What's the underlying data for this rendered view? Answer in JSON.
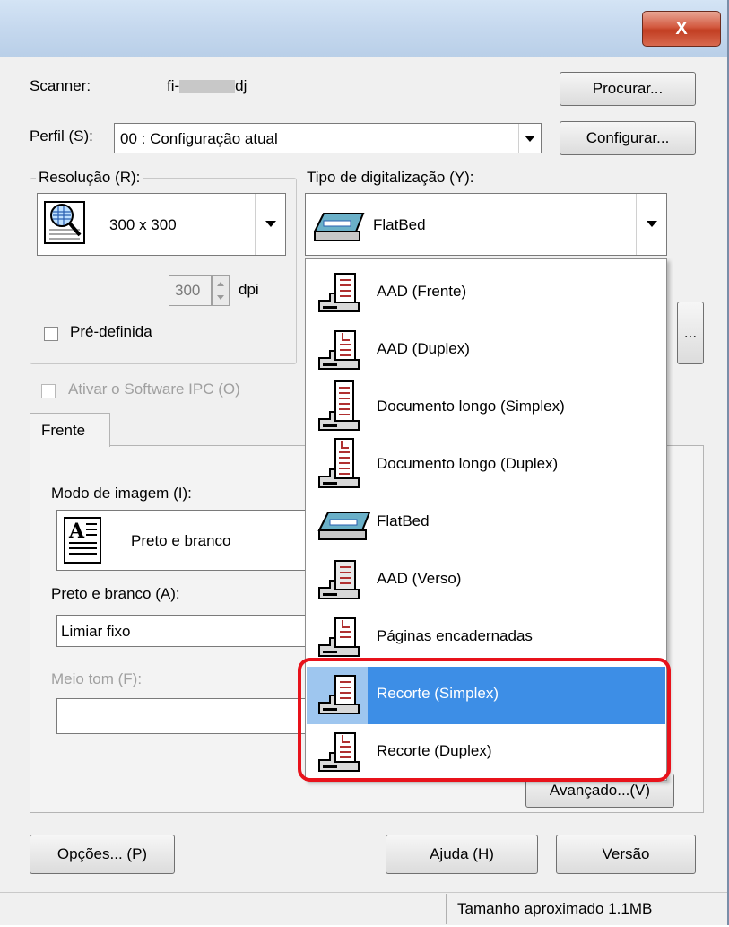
{
  "window": {
    "close_label": "X"
  },
  "scanner": {
    "label": "Scanner:",
    "name_prefix": "fi-",
    "name_suffix": "dj",
    "browse_button": "Procurar..."
  },
  "profile": {
    "label": "Perfil (S):",
    "value": "00 : Configuração atual",
    "config_button": "Configurar..."
  },
  "resolution": {
    "group_label": "Resolução (R):",
    "value": "300 x 300",
    "dpi_value": "300",
    "dpi_unit": "dpi",
    "predefined_label": "Pré-definida"
  },
  "scan_type": {
    "label": "Tipo de digitalização (Y):",
    "value": "FlatBed",
    "side_button": "..."
  },
  "ipc": {
    "label": "Ativar o Software IPC (O)"
  },
  "tabs": {
    "front": "Frente"
  },
  "image_mode": {
    "label": "Modo de imagem (I):",
    "value": "Preto e branco"
  },
  "bw": {
    "label": "Preto e branco (A):",
    "value": "Limiar fixo"
  },
  "halftone": {
    "label": "Meio tom (F):",
    "value": ""
  },
  "advanced_button": "Avançado...(V)",
  "dropdown": {
    "items": [
      {
        "label": "AAD (Frente)",
        "icon": "adf-scanner-icon"
      },
      {
        "label": "AAD (Duplex)",
        "icon": "adf-duplex-icon"
      },
      {
        "label": "Documento longo (Simplex)",
        "icon": "long-doc-simplex-icon"
      },
      {
        "label": "Documento longo (Duplex)",
        "icon": "long-doc-duplex-icon"
      },
      {
        "label": "FlatBed",
        "icon": "flatbed-scanner-icon"
      },
      {
        "label": "AAD (Verso)",
        "icon": "adf-back-icon"
      },
      {
        "label": "Páginas encadernadas",
        "icon": "bound-pages-icon"
      },
      {
        "label": "Recorte (Simplex)",
        "icon": "cropping-simplex-icon",
        "selected": true
      },
      {
        "label": "Recorte (Duplex)",
        "icon": "cropping-duplex-icon"
      }
    ],
    "highlight_color": "#e8121b",
    "selection_color": "#3d8ee6"
  },
  "footer": {
    "options_button": "Opções... (P)",
    "help_button": "Ajuda (H)",
    "version_button": "Versão"
  },
  "status": {
    "size_text": "Tamanho aproximado  1.1MB"
  }
}
